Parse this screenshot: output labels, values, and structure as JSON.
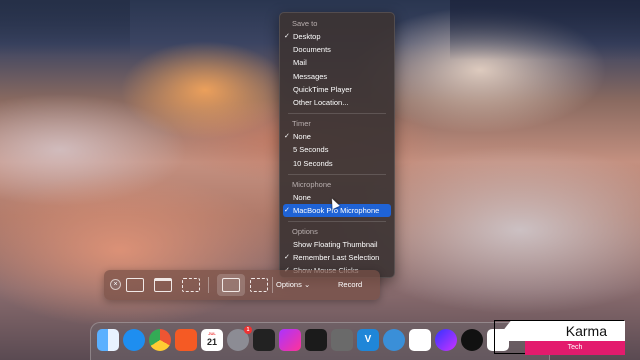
{
  "menu": {
    "save_to": {
      "title": "Save to",
      "items": [
        {
          "label": "Desktop",
          "checked": true
        },
        {
          "label": "Documents",
          "checked": false
        },
        {
          "label": "Mail",
          "checked": false
        },
        {
          "label": "Messages",
          "checked": false
        },
        {
          "label": "QuickTime Player",
          "checked": false
        },
        {
          "label": "Other Location...",
          "checked": false
        }
      ]
    },
    "timer": {
      "title": "Timer",
      "items": [
        {
          "label": "None",
          "checked": true
        },
        {
          "label": "5 Seconds",
          "checked": false
        },
        {
          "label": "10 Seconds",
          "checked": false
        }
      ]
    },
    "microphone": {
      "title": "Microphone",
      "items": [
        {
          "label": "None",
          "checked": false
        },
        {
          "label": "MacBook Pro Microphone",
          "checked": true,
          "highlighted": true
        }
      ]
    },
    "options": {
      "title": "Options",
      "items": [
        {
          "label": "Show Floating Thumbnail",
          "checked": false
        },
        {
          "label": "Remember Last Selection",
          "checked": true
        },
        {
          "label": "Show Mouse Clicks",
          "checked": true
        }
      ]
    },
    "check_glyph": "✓"
  },
  "toolbar": {
    "close_glyph": "×",
    "options_label": "Options",
    "options_chevron": "⌄",
    "record_label": "Record",
    "active_tool": "record-selected-portion"
  },
  "dock": {
    "calendar_month": "JUL",
    "calendar_day": "21",
    "badge_count": "1",
    "vscode_label": "V",
    "icons": [
      "finder-icon",
      "safari-icon",
      "chrome-icon",
      "brave-icon",
      "calendar-icon",
      "system-settings-icon",
      "terminal-icon",
      "final-cut-icon",
      "activity-monitor-icon",
      "calculator-icon",
      "vscode-icon",
      "quicktime-icon",
      "slack-icon",
      "siri-icon",
      "alexa-icon",
      "notes-icon"
    ]
  },
  "watermark": {
    "brand": "Karma",
    "sub": "Tech"
  },
  "colors": {
    "menu_bg": "#3c3434",
    "highlight": "#1f63d6",
    "watermark_pink": "#e31b6d"
  }
}
